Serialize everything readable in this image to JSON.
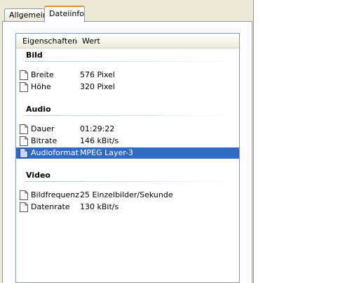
{
  "tabs": [
    {
      "label": "Allgemein",
      "active": false
    },
    {
      "label": "Dateiinfo",
      "active": true
    }
  ],
  "list": {
    "columns": [
      "Eigenschaften",
      "Wert"
    ],
    "groups": [
      {
        "title": "Bild",
        "rows": [
          {
            "property": "Breite",
            "value": "576 Pixel",
            "selected": false
          },
          {
            "property": "Höhe",
            "value": "320 Pixel",
            "selected": false
          }
        ]
      },
      {
        "title": "Audio",
        "rows": [
          {
            "property": "Dauer",
            "value": "01:29:22",
            "selected": false
          },
          {
            "property": "Bitrate",
            "value": "146 kBit/s",
            "selected": false
          },
          {
            "property": "Audioformat",
            "value": "MPEG Layer-3",
            "selected": true
          }
        ]
      },
      {
        "title": "Video",
        "rows": [
          {
            "property": "Bildfrequenz",
            "value": "25 Einzelbilder/Sekunde",
            "selected": false
          },
          {
            "property": "Datenrate",
            "value": "130 kBit/s",
            "selected": false
          }
        ]
      }
    ]
  },
  "colors": {
    "dialog_bg": "#ECE9D8",
    "selection": "#316AC5",
    "active_tab_accent": "#E68B2C"
  },
  "icons": {
    "row_icon": "document-icon"
  }
}
